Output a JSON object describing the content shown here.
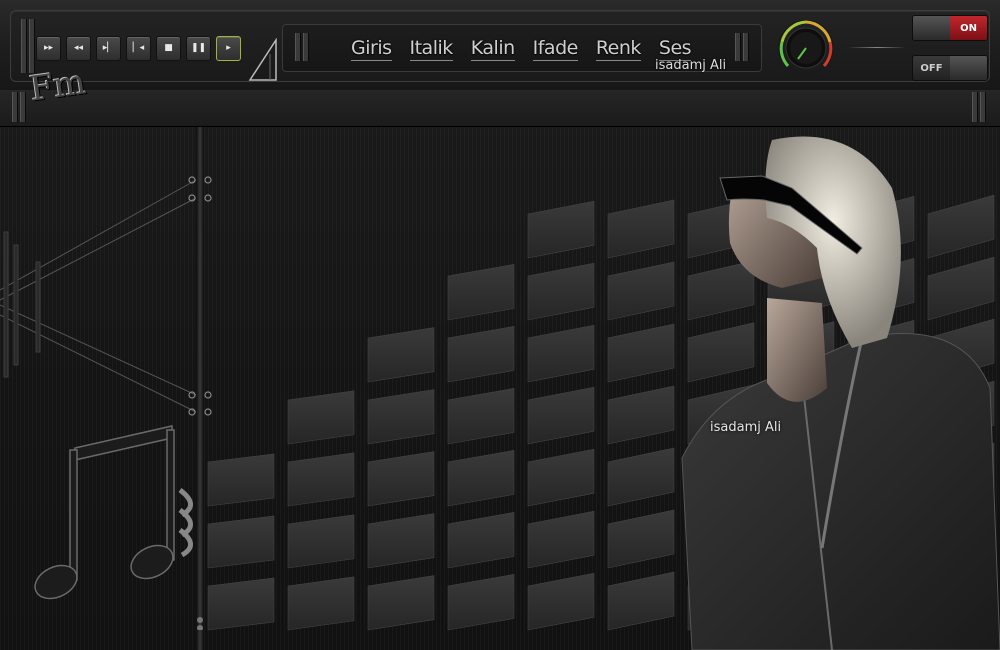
{
  "transport": {
    "buttons": [
      {
        "name": "fast-forward",
        "glyph": "▸▸"
      },
      {
        "name": "rewind",
        "glyph": "◂◂"
      },
      {
        "name": "next",
        "glyph": "▸▏"
      },
      {
        "name": "previous",
        "glyph": "▏◂"
      },
      {
        "name": "stop",
        "glyph": "■"
      },
      {
        "name": "pause",
        "glyph": "❚❚"
      },
      {
        "name": "play",
        "glyph": "▸"
      }
    ]
  },
  "nav": {
    "items": [
      "Giris",
      "Italik",
      "Kalin",
      "Ifade",
      "Renk",
      "Ses"
    ]
  },
  "signature": {
    "top": "isadamj Ali",
    "middle": "isadamj Ali"
  },
  "logo": {
    "text": "Fm"
  },
  "switches": {
    "on_label": "ON",
    "off_label": "OFF"
  },
  "colors": {
    "accent_red": "#c0272d",
    "active_green": "#9ab832",
    "knob_green": "#5fc24a",
    "knob_red": "#d33c2c"
  }
}
